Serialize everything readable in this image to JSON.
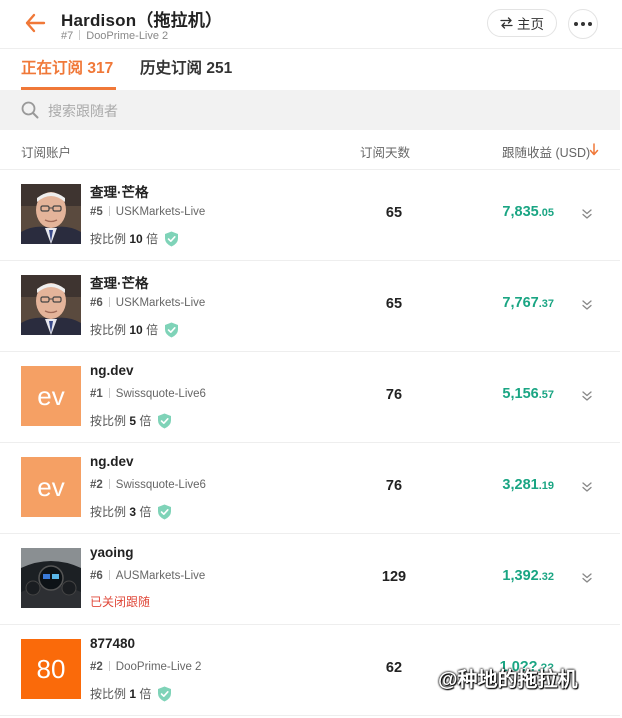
{
  "header": {
    "title": "Hardison（拖拉机）",
    "rank": "#7",
    "account": "DooPrime-Live 2",
    "home_label": "主页"
  },
  "tabs": [
    {
      "label": "正在订阅",
      "count": "317",
      "active": true
    },
    {
      "label": "历史订阅",
      "count": "251",
      "active": false
    }
  ],
  "search": {
    "placeholder": "搜索跟随者"
  },
  "columns": {
    "account": "订阅账户",
    "days": "订阅天数",
    "profit": "跟随收益 (USD)"
  },
  "rows": [
    {
      "name": "查理·芒格",
      "rank": "#5",
      "account": "USKMarkets-Live",
      "ratio_prefix": "按比例",
      "ratio": "10",
      "ratio_suffix": "倍",
      "days": "65",
      "profit_int": "7,835",
      "profit_dec": ".05",
      "avatar": "photo-man"
    },
    {
      "name": "查理·芒格",
      "rank": "#6",
      "account": "USKMarkets-Live",
      "ratio_prefix": "按比例",
      "ratio": "10",
      "ratio_suffix": "倍",
      "days": "65",
      "profit_int": "7,767",
      "profit_dec": ".37",
      "avatar": "photo-man"
    },
    {
      "name": "ng.dev",
      "rank": "#1",
      "account": "Swissquote-Live6",
      "ratio_prefix": "按比例",
      "ratio": "5",
      "ratio_suffix": "倍",
      "days": "76",
      "profit_int": "5,156",
      "profit_dec": ".57",
      "avatar": "ev"
    },
    {
      "name": "ng.dev",
      "rank": "#2",
      "account": "Swissquote-Live6",
      "ratio_prefix": "按比例",
      "ratio": "3",
      "ratio_suffix": "倍",
      "days": "76",
      "profit_int": "3,281",
      "profit_dec": ".19",
      "avatar": "ev"
    },
    {
      "name": "yaoing",
      "rank": "#6",
      "account": "AUSMarkets-Live",
      "status": "已关闭跟随",
      "days": "129",
      "profit_int": "1,392",
      "profit_dec": ".32",
      "avatar": "photo-car"
    },
    {
      "name": "877480",
      "rank": "#2",
      "account": "DooPrime-Live 2",
      "ratio_prefix": "按比例",
      "ratio": "1",
      "ratio_suffix": "倍",
      "days": "62",
      "profit_int": "1,0??",
      "profit_dec": ".??",
      "avatar": "80"
    }
  ],
  "avatar_text": {
    "ev": "ev",
    "num": "80"
  },
  "watermark": "@种地的拖拉机",
  "colors": {
    "accent": "#f07838",
    "profit": "#1aa583",
    "closed": "#e0483a",
    "avatar_ev": "#f5a064",
    "avatar_num": "#fa6a0a"
  },
  "icons": {
    "back": "arrow-left-icon",
    "home": "swap-icon",
    "more": "more-dots-icon",
    "search": "search-icon",
    "sort": "arrow-down-icon",
    "verified": "shield-check-icon",
    "expand": "chevron-double-down-icon"
  }
}
